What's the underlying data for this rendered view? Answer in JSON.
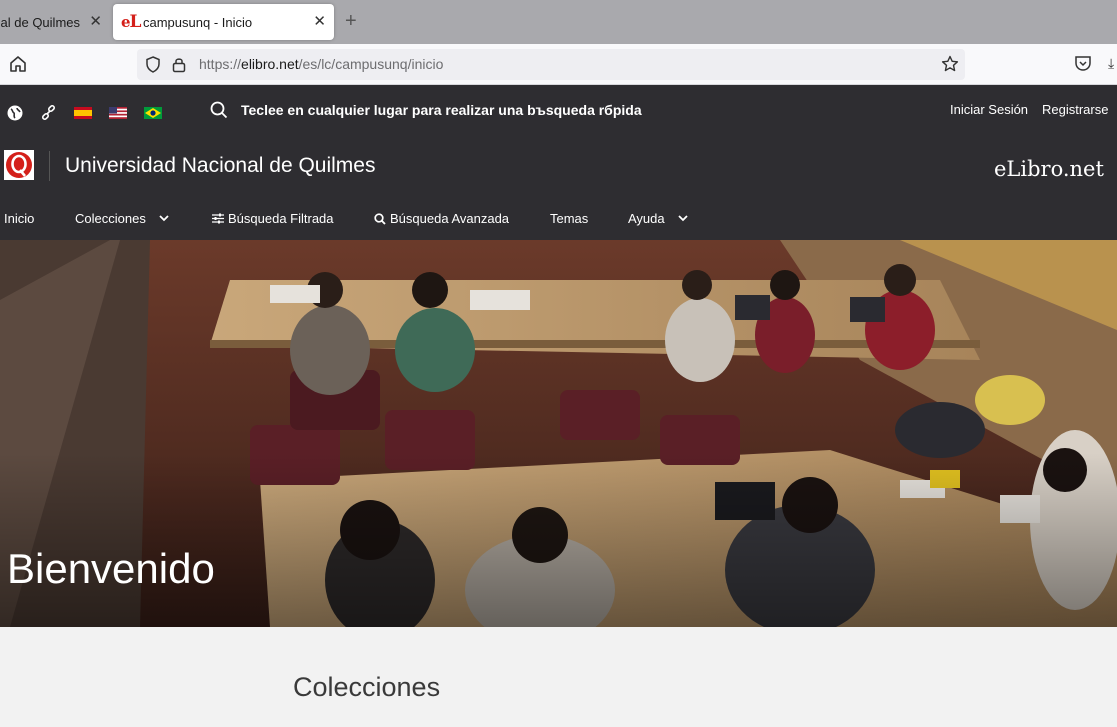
{
  "browser": {
    "tabs": [
      {
        "title": "Universidad Nacional de Quilmes",
        "active": false
      },
      {
        "title": "campusunq - Inicio",
        "active": true
      }
    ],
    "close_glyph": "✕",
    "newtab_glyph": "+",
    "url": {
      "prefix": "https://",
      "domain": "elibro.net",
      "path": "/es/lc/campusunq/inicio"
    }
  },
  "topbar": {
    "icons": [
      "globe-icon",
      "link-icon"
    ],
    "flags": [
      "flag-es",
      "flag-us",
      "flag-br"
    ],
    "search_hint": "Teclee en cualquier lugar para realizar una bъsqueda rбpida",
    "login": "Iniciar Sesión",
    "register": "Registrarse"
  },
  "header": {
    "institution": "Universidad Nacional de Quilmes",
    "brand": "eLibro.net",
    "logo_letter": "Q"
  },
  "menu": [
    {
      "label": "Inicio",
      "icon": null,
      "dropdown": false
    },
    {
      "label": "Colecciones",
      "icon": null,
      "dropdown": true
    },
    {
      "label": "Búsqueda Filtrada",
      "icon": "sliders-icon",
      "dropdown": false
    },
    {
      "label": "Búsqueda Avanzada",
      "icon": "search-icon",
      "dropdown": false
    },
    {
      "label": "Temas",
      "icon": null,
      "dropdown": false
    },
    {
      "label": "Ayuda",
      "icon": null,
      "dropdown": true
    }
  ],
  "hero": {
    "title": "Bienvenido"
  },
  "section": {
    "title": "Colecciones"
  },
  "colors": {
    "header_bg": "#2e2d31",
    "brand_red": "#d4201a",
    "page_bg": "#f2f2f2"
  }
}
